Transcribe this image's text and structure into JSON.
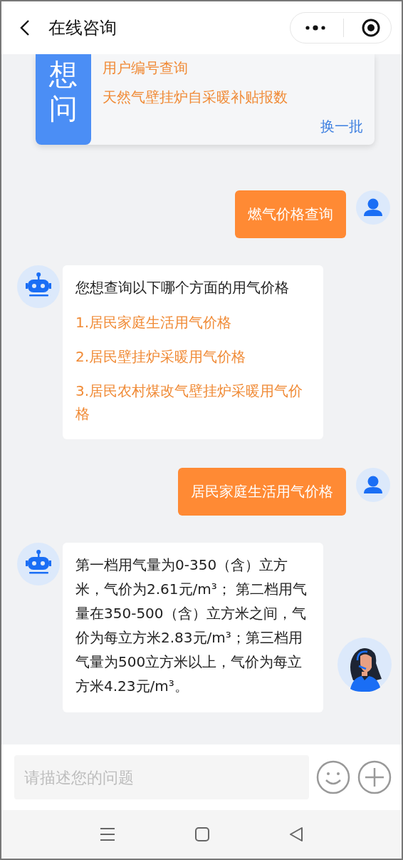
{
  "header": {
    "title": "在线咨询"
  },
  "quick_card": {
    "badge": "想问",
    "questions": [
      "用户编号查询",
      "天然气壁挂炉自采暖补贴报数"
    ],
    "refresh": "换一批"
  },
  "messages": [
    {
      "kind": "user",
      "text": "燃气价格查询"
    },
    {
      "kind": "bot",
      "text": "您想查询以下哪个方面的用气价格",
      "options": [
        "1.居民家庭生活用气价格",
        "2.居民壁挂炉采暖用气价格",
        "3.居民农村煤改气壁挂炉采暖用气价格"
      ]
    },
    {
      "kind": "user",
      "text": "居民家庭生活用气价格"
    },
    {
      "kind": "bot",
      "text": "第一档用气量为0-350（含）立方米，气价为2.61元/m³； 第二档用气量在350-500（含）立方米之间，气价为每立方米2.83元/m³；第三档用气量为500立方米以上，气价为每立方米4.23元/m³。"
    }
  ],
  "input": {
    "placeholder": "请描述您的问题"
  }
}
